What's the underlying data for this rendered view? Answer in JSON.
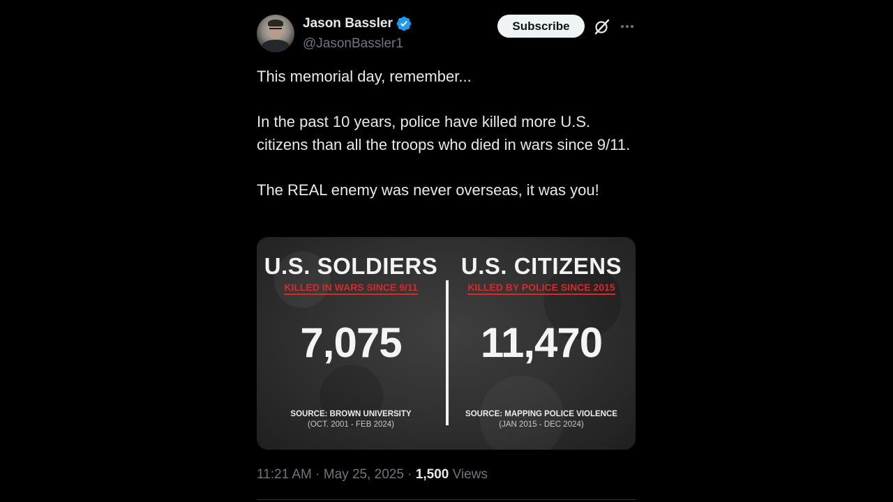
{
  "author": {
    "display_name": "Jason Bassler",
    "handle": "@JasonBassler1"
  },
  "actions": {
    "subscribe_label": "Subscribe"
  },
  "tweet": {
    "paragraphs": [
      "This memorial day, remember...",
      "In the past 10 years, police have killed more U.S. citizens than all the troops who died in wars since 9/11.",
      "The REAL enemy was never overseas, it was you!"
    ]
  },
  "media": {
    "left": {
      "title": "U.S. SOLDIERS",
      "subtitle": "KILLED IN WARS SINCE 9/11",
      "number": "7,075",
      "source": "SOURCE: BROWN UNIVERSITY",
      "range": "(OCT. 2001 - FEB 2024)"
    },
    "right": {
      "title": "U.S. CITIZENS",
      "subtitle": "KILLED BY POLICE SINCE 2015",
      "number": "11,470",
      "source": "SOURCE: MAPPING POLICE VIOLENCE",
      "range": "(JAN 2015 - DEC 2024)"
    }
  },
  "meta": {
    "time": "11:21 AM",
    "separator": " · ",
    "date": "May 25, 2025",
    "views_count": "1,500",
    "views_label": "Views"
  },
  "colors": {
    "background": "#000000",
    "text": "#e7e9ea",
    "secondary": "#71767b",
    "verified": "#1d9bf0",
    "accent_red": "#d42b2b"
  },
  "icons": {
    "verified": "verified-badge-icon",
    "grok": "grok-icon",
    "more": "more-horizontal-icon"
  }
}
